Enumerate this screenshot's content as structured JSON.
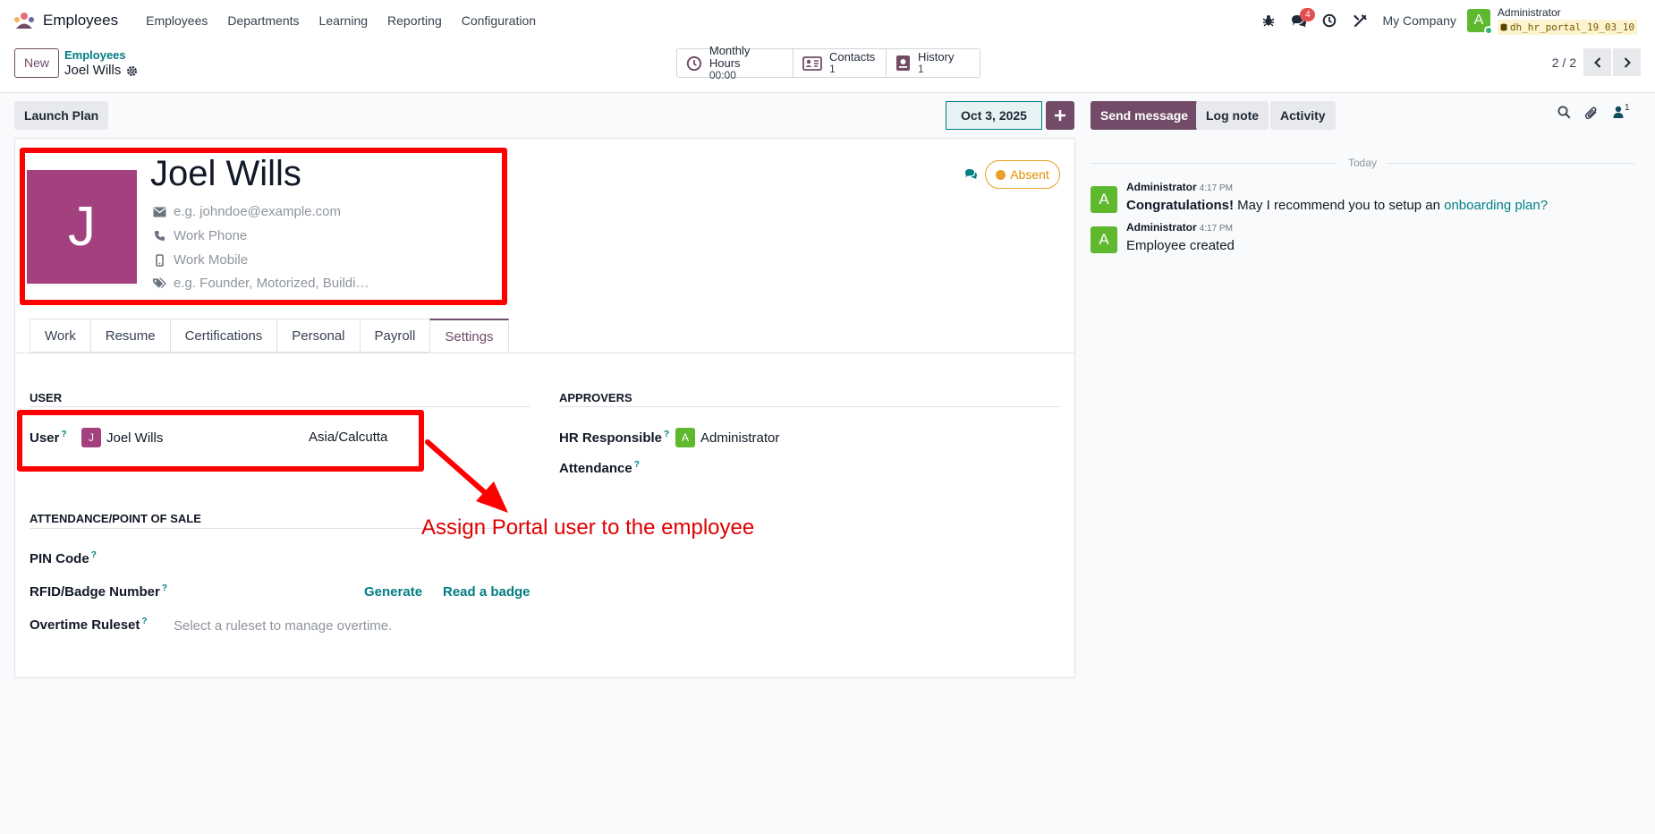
{
  "navbar": {
    "app_name": "Employees",
    "menus": [
      "Employees",
      "Departments",
      "Learning",
      "Reporting",
      "Configuration"
    ],
    "messages_badge": "4",
    "company": "My Company",
    "user_initial": "A",
    "user_name": "Administrator",
    "database": "dh_hr_portal_19_03_10"
  },
  "control_panel": {
    "new_label": "New",
    "breadcrumb_parent": "Employees",
    "breadcrumb_current": "Joel Wills",
    "smart_buttons": [
      {
        "title": "Monthly Hours",
        "value": "00:00"
      },
      {
        "title": "Contacts",
        "value": "1"
      },
      {
        "title": "History",
        "value": "1"
      }
    ],
    "pager": "2 / 2"
  },
  "statusbar": {
    "launch_plan": "Launch Plan",
    "date": "Oct 3, 2025",
    "plus": "+"
  },
  "employee": {
    "avatar_initial": "J",
    "name": "Joel Wills",
    "email_placeholder": "e.g. johndoe@example.com",
    "phone_placeholder": "Work Phone",
    "mobile_placeholder": "Work Mobile",
    "tags_placeholder": "e.g. Founder, Motorized, Buildi…",
    "status": "Absent"
  },
  "tabs": [
    "Work",
    "Resume",
    "Certifications",
    "Personal",
    "Payroll",
    "Settings"
  ],
  "settings": {
    "user_section": "USER",
    "user_label": "User",
    "user_initial": "J",
    "user_value": "Joel Wills",
    "timezone": "Asia/Calcutta",
    "approvers_section": "APPROVERS",
    "hr_responsible_label": "HR Responsible",
    "hr_responsible_initial": "A",
    "hr_responsible_value": "Administrator",
    "attendance_label": "Attendance",
    "attendance_section": "ATTENDANCE/POINT OF SALE",
    "pin_label": "PIN Code",
    "rfid_label": "RFID/Badge Number",
    "generate": "Generate",
    "read_badge": "Read a badge",
    "overtime_label": "Overtime Ruleset",
    "overtime_placeholder": "Select a ruleset to manage overtime."
  },
  "annotation": "Assign Portal user to the employee",
  "chatter": {
    "send_message": "Send message",
    "log_note": "Log note",
    "activity": "Activity",
    "followers": "1",
    "today": "Today",
    "messages": [
      {
        "initial": "A",
        "author": "Administrator",
        "time": "4:17 PM",
        "bold": "Congratulations!",
        "text": " May I recommend you to setup an ",
        "link": "onboarding plan?"
      },
      {
        "initial": "A",
        "author": "Administrator",
        "time": "4:17 PM",
        "text": "Employee created"
      }
    ]
  },
  "colors": {
    "brand": "#714b67",
    "link": "#017e84",
    "annotation": "#ff0000",
    "avatar_employee": "#a2417e",
    "avatar_admin": "#5fb92e",
    "absent": "#e8a028"
  },
  "icons": [
    "app-logo-icon",
    "bug-icon",
    "chat-icon",
    "clock-icon",
    "tools-icon",
    "gear-icon",
    "envelope-icon",
    "phone-icon",
    "mobile-icon",
    "tags-icon",
    "search-icon",
    "paperclip-icon",
    "followers-icon",
    "chevron-left-icon",
    "chevron-right-icon",
    "plus-icon",
    "comments-icon",
    "database-icon"
  ]
}
